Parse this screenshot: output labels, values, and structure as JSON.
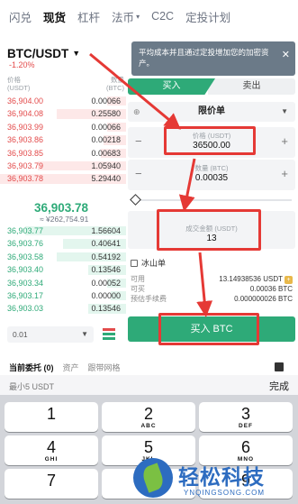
{
  "tabs": [
    "闪兑",
    "现货",
    "杠杆",
    "法币",
    "C2C",
    "定投计划"
  ],
  "pair": {
    "name": "BTC/USDT",
    "change": "-1.20%"
  },
  "orderbook": {
    "head_left": [
      "价格",
      "(USDT)"
    ],
    "head_right": [
      "数量",
      "(BTC)"
    ],
    "asks": [
      {
        "price": "36,904.00",
        "qty": "0.00066",
        "depth": 0.15
      },
      {
        "price": "36,904.08",
        "qty": "0.25580",
        "depth": 0.55
      },
      {
        "price": "36,903.99",
        "qty": "0.00066",
        "depth": 0.15
      },
      {
        "price": "36,903.86",
        "qty": "0.00218",
        "depth": 0.18
      },
      {
        "price": "36,903.85",
        "qty": "0.00683",
        "depth": 0.2
      },
      {
        "price": "36,903.79",
        "qty": "1.05940",
        "depth": 0.7
      },
      {
        "price": "36,903.78",
        "qty": "5.29440",
        "depth": 1.0
      }
    ],
    "mid_price": "36,903.78",
    "mid_fiat": "≈ ¥262,754.91",
    "bids": [
      {
        "price": "36,903.77",
        "qty": "1.56604",
        "depth": 0.8
      },
      {
        "price": "36,903.76",
        "qty": "0.40641",
        "depth": 0.5
      },
      {
        "price": "36,903.58",
        "qty": "0.54192",
        "depth": 0.55
      },
      {
        "price": "36,903.40",
        "qty": "0.13546",
        "depth": 0.3
      },
      {
        "price": "36,903.34",
        "qty": "0.00052",
        "depth": 0.15
      },
      {
        "price": "36,903.17",
        "qty": "0.00000",
        "depth": 0.12
      },
      {
        "price": "36,903.03",
        "qty": "0.13546",
        "depth": 0.3
      }
    ],
    "depth_select": "0.01"
  },
  "tip": {
    "text": "平均成本并且通过定投增加您的加密资产。",
    "close": "✕"
  },
  "trade": {
    "buy_tab": "买入",
    "sell_tab": "卖出",
    "order_type": "限价单",
    "info_icon": "⊕",
    "price_label": "价格 (USDT)",
    "price_value": "36500.00",
    "qty_label": "数量 (BTC)",
    "qty_value": "0.00035",
    "slider_level": 0,
    "total_label": "成交金额 (USDT)",
    "total_value": "13",
    "iceberg": "冰山单",
    "available_label": "可用",
    "available_value": "13.14938536 USDT",
    "buyable_label": "可买",
    "buyable_value": "0.00036 BTC",
    "fee_label": "预估手续费",
    "fee_value": "0.000000026 BTC",
    "buy_button": "买入 BTC"
  },
  "bottom_tabs": [
    "当前委托 (0)",
    "资产",
    "跟带网格"
  ],
  "keyboard": {
    "hint": "最小5 USDT",
    "done": "完成",
    "keys": [
      {
        "d": "1",
        "s": ""
      },
      {
        "d": "2",
        "s": "ABC"
      },
      {
        "d": "3",
        "s": "DEF"
      },
      {
        "d": "4",
        "s": "GHI"
      },
      {
        "d": "5",
        "s": "JKL"
      },
      {
        "d": "6",
        "s": "MNO"
      },
      {
        "d": "7",
        "s": ""
      },
      {
        "d": "8",
        "s": ""
      },
      {
        "d": "9",
        "s": ""
      }
    ]
  },
  "watermark": {
    "name": "轻松科技",
    "url": "YNQINGSONG.COM"
  },
  "colors": {
    "buy": "#2eaa78",
    "sell": "#e34b4b",
    "highlight": "#e53935"
  }
}
